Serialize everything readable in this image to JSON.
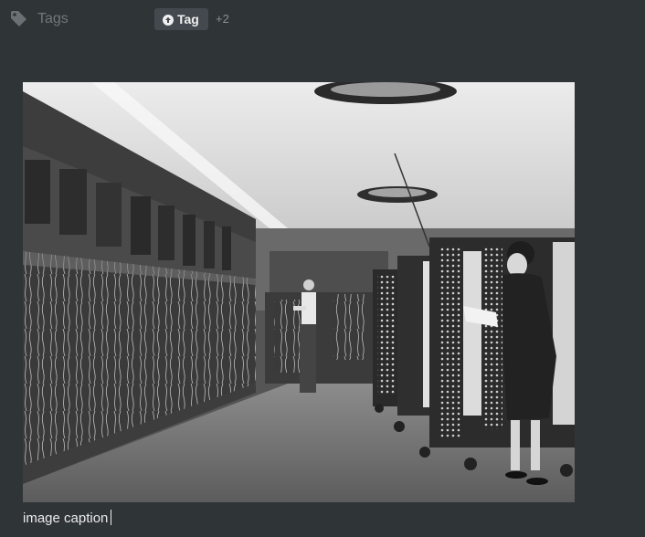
{
  "properties": {
    "tags": {
      "label": "Tags",
      "icon": "tag-icon",
      "chip_label": "Tag",
      "chip_icon": "arrow-up-circle-icon",
      "more_count": "+2"
    }
  },
  "image": {
    "icon": "photo-image"
  },
  "caption": {
    "text": "image caption"
  },
  "colors": {
    "background": "#2f3437",
    "chip_background": "#43494e",
    "muted_text": "#72777c"
  }
}
